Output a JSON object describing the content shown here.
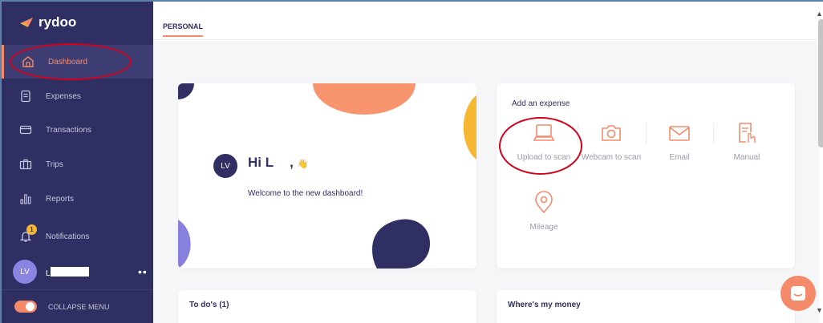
{
  "app": {
    "brand": "rydoo"
  },
  "sidebar": {
    "items": [
      {
        "label": "Dashboard",
        "icon": "home-icon",
        "active": true
      },
      {
        "label": "Expenses",
        "icon": "receipt-icon",
        "active": false
      },
      {
        "label": "Transactions",
        "icon": "card-icon",
        "active": false
      },
      {
        "label": "Trips",
        "icon": "suitcase-icon",
        "active": false
      },
      {
        "label": "Reports",
        "icon": "bar-chart-icon",
        "active": false
      },
      {
        "label": "Notifications",
        "icon": "bell-icon",
        "active": false,
        "badge": "1"
      }
    ],
    "user": {
      "initials": "LV",
      "name": "L"
    },
    "collapse_label": "COLLAPSE MENU"
  },
  "tabs": [
    {
      "label": "PERSONAL",
      "active": true
    }
  ],
  "welcome": {
    "initials": "LV",
    "greeting": "Hi L",
    "comma": ",",
    "wave": "👋",
    "message": "Welcome to the new dashboard!"
  },
  "add_expense": {
    "title": "Add an expense",
    "options": [
      {
        "label": "Upload to scan",
        "icon": "laptop-icon"
      },
      {
        "label": "Webcam to scan",
        "icon": "camera-icon"
      },
      {
        "label": "Email",
        "icon": "mail-icon"
      },
      {
        "label": "Manual",
        "icon": "manual-entry-icon"
      },
      {
        "label": "Mileage",
        "icon": "location-pin-icon"
      }
    ]
  },
  "todos": {
    "title": "To do's (1)"
  },
  "money": {
    "title": "Where's my money"
  },
  "colors": {
    "sidebar_bg": "#2f2f63",
    "accent": "#f58a6b",
    "annotation": "#d5001a"
  }
}
